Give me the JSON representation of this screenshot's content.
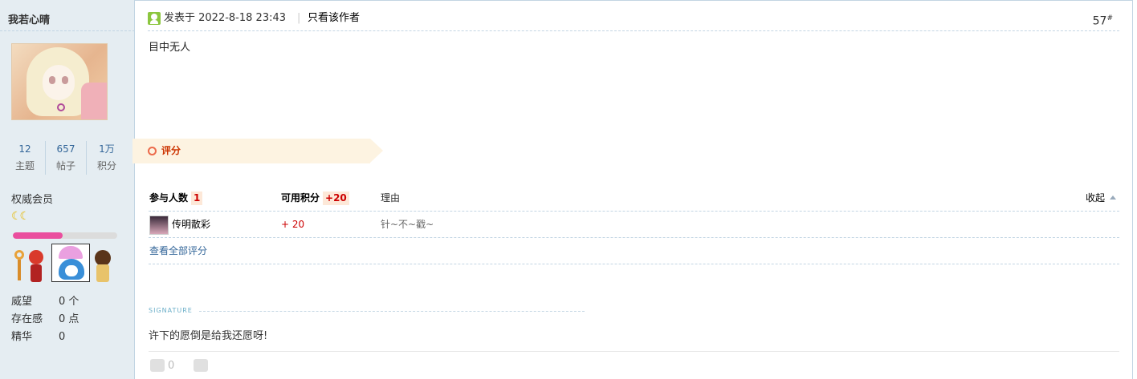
{
  "author": {
    "name": "我若心晴",
    "stats": [
      {
        "num": "12",
        "label": "主题"
      },
      {
        "num": "657",
        "label": "帖子"
      },
      {
        "num": "1万",
        "label": "积分"
      }
    ],
    "group": "权威会员",
    "rank_icons": "☾☾",
    "level_progress_percent": 48,
    "medals": [
      "key-medal",
      "red-girl-medal",
      "penguin-medal",
      "lady-medal"
    ],
    "info": [
      {
        "key": "威望",
        "value": "0 个"
      },
      {
        "key": "存在感",
        "value": "0 点"
      },
      {
        "key": "精华",
        "value": "0"
      }
    ]
  },
  "post": {
    "posted_at": "发表于 2022-8-18 23:43",
    "separator": "|",
    "only_author": "只看该作者",
    "floor": "57",
    "floor_mark": "#",
    "content": "目中无人"
  },
  "rating": {
    "title": "评分",
    "header": {
      "participants_label": "参与人数",
      "participants_count": "1",
      "points_label": "可用积分",
      "points_value": "+20",
      "reason_label": "理由",
      "collapse_label": "收起"
    },
    "rows": [
      {
        "user": "传明散彩",
        "points": "+ 20",
        "reason": "针~不~戳~"
      }
    ],
    "view_all": "查看全部评分"
  },
  "signature": {
    "label": "SIGNATURE",
    "text": "许下的愿倒是给我还愿呀!"
  },
  "votes": {
    "up_count": "0"
  },
  "colors": {
    "sidebar_bg": "#e5edf2",
    "border": "#c2d5e3",
    "link": "#336699",
    "accent_red": "#cc0000",
    "progress_pink": "#ea4e9e"
  }
}
